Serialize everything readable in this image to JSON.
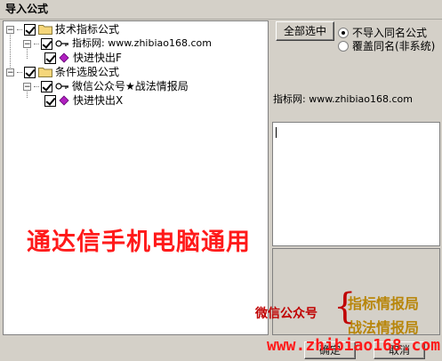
{
  "window": {
    "title": "导入公式"
  },
  "tree": {
    "nodes": [
      {
        "label": "技术指标公式",
        "type": "folder"
      },
      {
        "label": "指标网: www.zhibiao168.com",
        "type": "key"
      },
      {
        "label": "快进快出F",
        "type": "formula"
      },
      {
        "label": "条件选股公式",
        "type": "folder"
      },
      {
        "label": "微信公众号★战法情报局",
        "type": "key"
      },
      {
        "label": "快进快出X",
        "type": "formula"
      }
    ]
  },
  "options": {
    "select_all": "全部选中",
    "radio_skip": "不导入同名公式",
    "radio_overwrite": "覆盖同名(非系统)"
  },
  "info_text": "指标网: www.zhibiao168.com",
  "overlay": {
    "headline": "通达信手机电脑通用",
    "wechat_label": "微信公众号",
    "brace": "{",
    "tag_1": "指标情报局",
    "tag_2": "战法情报局",
    "url": "www.zhibiao168.com"
  },
  "buttons": {
    "confirm": "确定",
    "cancel": "取消"
  },
  "colors": {
    "overlay_red": "#ff1a1a",
    "overlay_gold": "#b8860b",
    "folder": "#f5d67a"
  }
}
